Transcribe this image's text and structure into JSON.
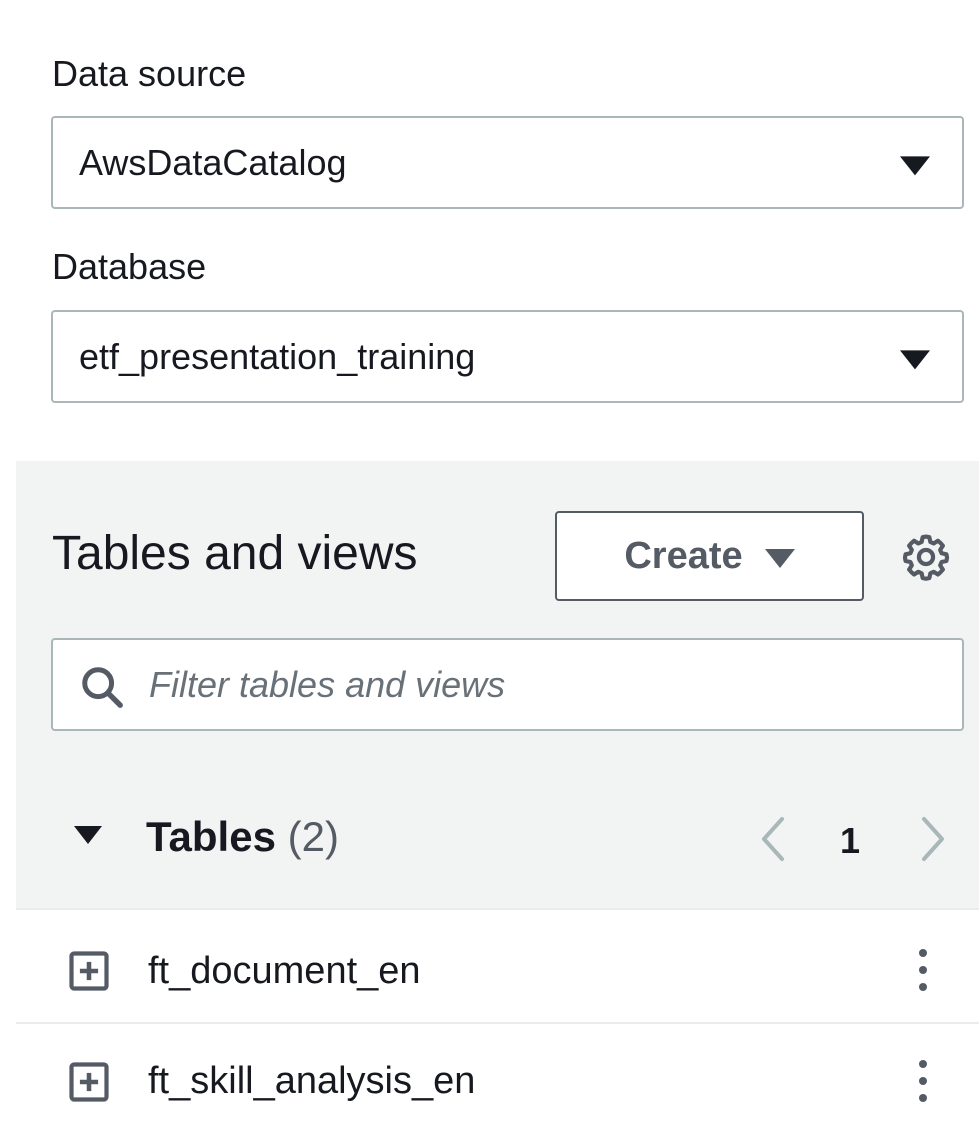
{
  "data_source": {
    "label": "Data source",
    "selected": "AwsDataCatalog"
  },
  "database": {
    "label": "Database",
    "selected": "etf_presentation_training"
  },
  "tables_and_views": {
    "title": "Tables and views",
    "create_label": "Create",
    "settings_icon": "gear-icon",
    "filter_placeholder": "Filter tables and views"
  },
  "tables": {
    "label": "Tables",
    "count": "(2)",
    "page": "1",
    "items": [
      {
        "name": "ft_document_en"
      },
      {
        "name": "ft_skill_analysis_en"
      }
    ]
  },
  "colors": {
    "text": "#16191f",
    "border": "#aab7b8",
    "section_bg": "#f2f3f3",
    "button_text": "#545b64",
    "disabled": "#aab7b8"
  }
}
